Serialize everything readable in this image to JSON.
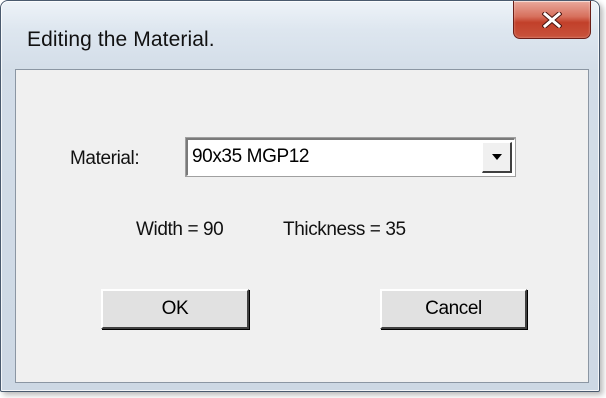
{
  "window": {
    "title": "Editing the Material.",
    "close_icon": "close-x-icon",
    "close_color": "#c2402a"
  },
  "form": {
    "material_label": "Material:",
    "material_value": "90x35 MGP12",
    "dropdown_icon": "dropdown-arrow-icon",
    "width_text": "Width = 90",
    "thickness_text": "Thickness = 35"
  },
  "buttons": {
    "ok_label": "OK",
    "cancel_label": "Cancel"
  }
}
